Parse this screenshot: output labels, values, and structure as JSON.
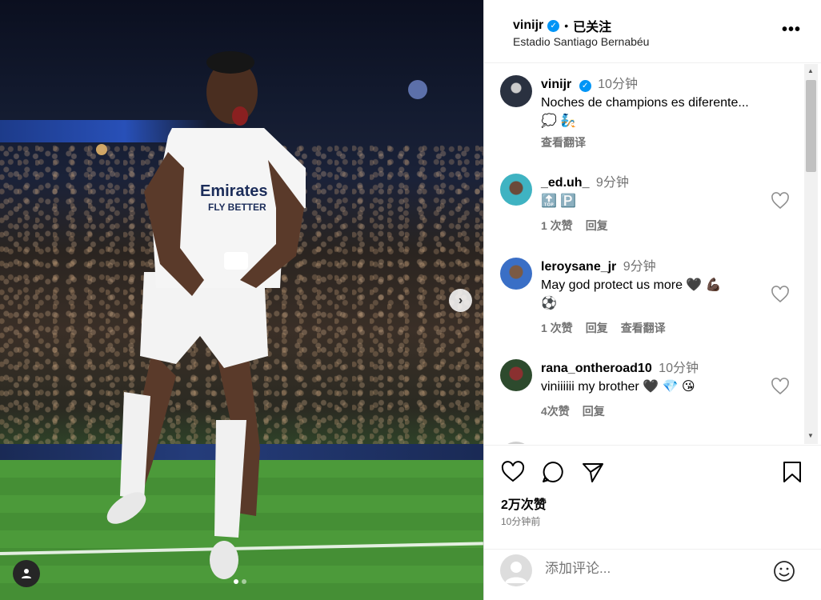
{
  "post": {
    "username": "vinijr",
    "follow_status": "已关注",
    "separator": "•",
    "location": "Estadio Santiago Bernabéu",
    "more_label": "•••",
    "carousel_next": "›"
  },
  "caption": {
    "username": "vinijr",
    "time": "10分钟",
    "text": "Noches de champions es diferente...",
    "emoji_line": "💭 🧞",
    "translate": "查看翻译"
  },
  "comments": [
    {
      "username": "_ed.uh_",
      "time": "9分钟",
      "text": "🔝 🅿️",
      "likes": "1 次赞",
      "reply": "回复"
    },
    {
      "username": "leroysane_jr",
      "time": "9分钟",
      "text": "May god protect us more 🖤 💪🏿",
      "text2": "⚽",
      "likes": "1 次赞",
      "reply": "回复",
      "translate": "查看翻译"
    },
    {
      "username": "rana_ontheroad10",
      "time": "10分钟",
      "text": "viniiiiii my brother 🖤 💎 😘",
      "likes": "4次赞",
      "reply": "回复"
    }
  ],
  "stats": {
    "likes": "2万次赞",
    "posted": "10分钟前"
  },
  "add_comment": {
    "placeholder": "添加评论..."
  },
  "colors": {
    "verified": "#0095f6",
    "muted": "#737373"
  }
}
